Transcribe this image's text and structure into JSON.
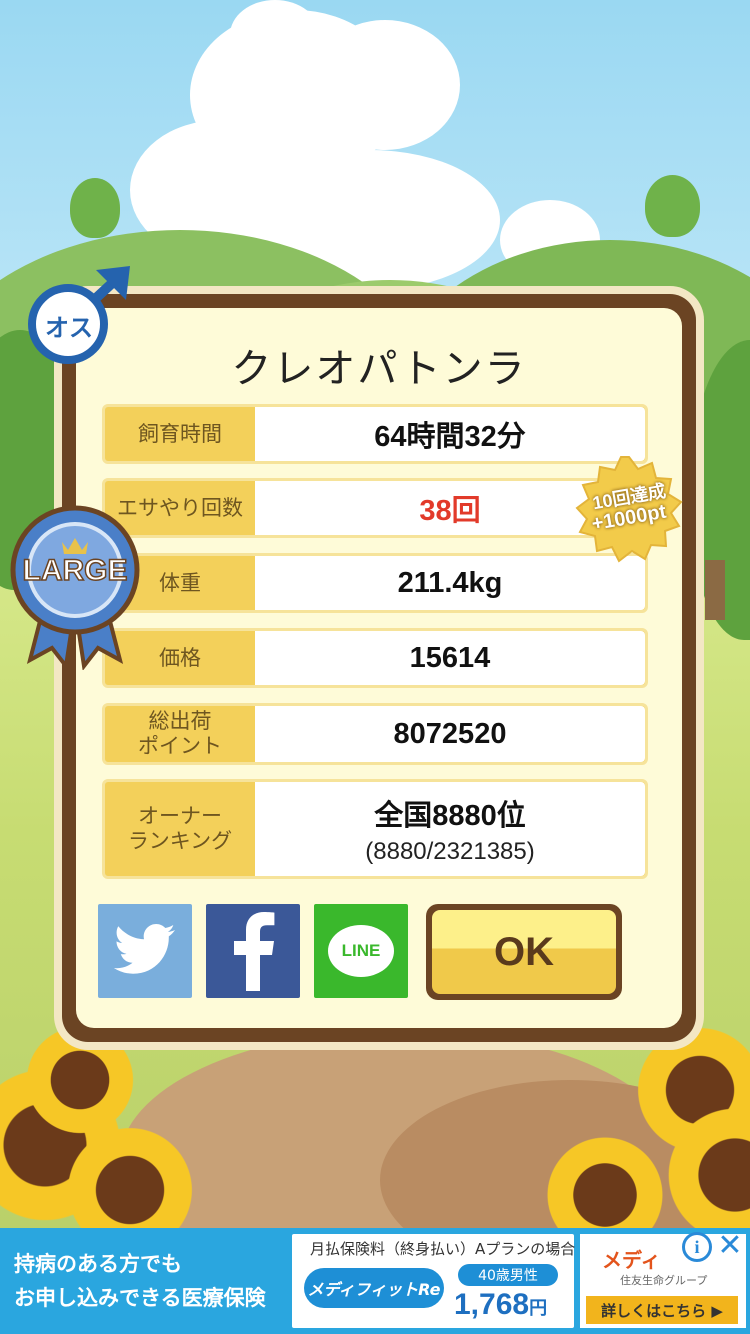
{
  "pig": {
    "gender_label": "オス",
    "name": "クレオパトンラ",
    "size_ribbon": "LARGE"
  },
  "stats": {
    "rows": [
      {
        "label": "飼育時間",
        "value": "64時間32分"
      },
      {
        "label": "エサやり回数",
        "value": "38回"
      },
      {
        "label": "体重",
        "value": "211.4kg"
      },
      {
        "label": "価格",
        "value": "15614"
      },
      {
        "label_line1": "総出荷",
        "label_line2": "ポイント",
        "value": "8072520"
      },
      {
        "label_line1": "オーナー",
        "label_line2": "ランキング",
        "value": "全国8880位",
        "sub": "(8880/2321385)"
      }
    ]
  },
  "achievement_seal": {
    "line1": "10回達成",
    "line2": "+1000pt"
  },
  "share": {
    "twitter_icon": "twitter-bird-icon",
    "facebook_icon": "facebook-f-icon",
    "line_label": "LINE"
  },
  "ok_button": {
    "label": "OK"
  },
  "ad": {
    "left_line1": "持病のある方でも",
    "left_line2": "お申し込みできる医療保険",
    "mid_line1": "月払保険料（終身払い）Aプランの場合",
    "product": "メディフィットRe",
    "target": "40歳男性",
    "price": "1,768",
    "price_unit": "円",
    "brand": "メディ",
    "group": "住友生命グループ",
    "cta": "詳しくはこちら ▶",
    "info": "i",
    "close": "✕"
  },
  "colors": {
    "sky": "#9ad8f2",
    "panel_border": "#6b4423",
    "panel_fill": "#fefbd8",
    "row_label_bg": "#f3d05a",
    "highlight_red": "#e23a2a",
    "twitter": "#7aaedc",
    "facebook": "#3b5898",
    "line": "#3ab82c",
    "ad_blue": "#2aa6df"
  }
}
